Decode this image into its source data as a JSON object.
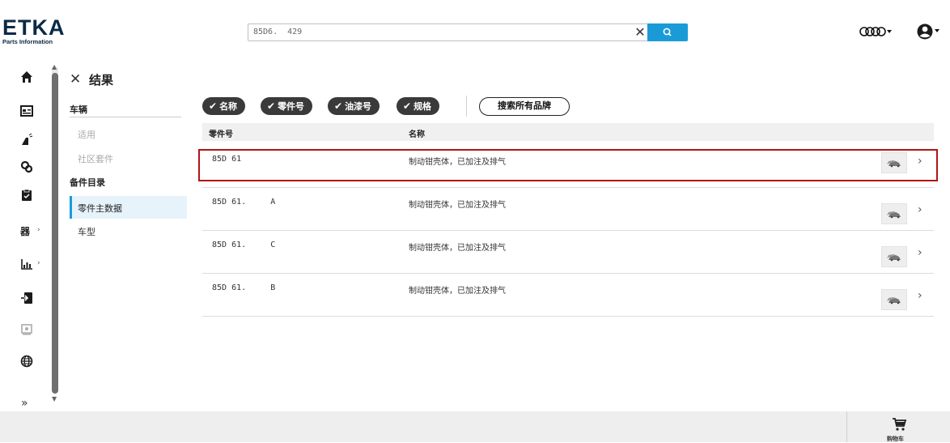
{
  "app": {
    "logo_title": "ETKA",
    "logo_subtitle": "Parts Information"
  },
  "search": {
    "value": "85D6.  429"
  },
  "sidebar": {
    "icons": [
      "home-icon",
      "catalog-icon",
      "tools-icon",
      "parts-icon",
      "clipboard-icon",
      "vin-icon",
      "chart-icon",
      "import-icon",
      "viewer-icon",
      "globe-icon"
    ],
    "expand_label": "»"
  },
  "panel": {
    "close_label": "✕",
    "title": "结果",
    "section_vehicle": "车辆",
    "item_applicable": "适用",
    "item_community_kit": "社区套件",
    "section_parts_catalog": "备件目录",
    "item_parts_master": "零件主数据",
    "item_model": "车型"
  },
  "filters": {
    "chips": [
      "名称",
      "零件号",
      "油漆号",
      "规格"
    ],
    "search_all_brands": "搜索所有品牌"
  },
  "table": {
    "headers": {
      "part_no": "零件号",
      "name": "名称"
    },
    "rows": [
      {
        "part_no": "85D 61     ",
        "name": "制动钳壳体，已加注及排气"
      },
      {
        "part_no": "85D 61.     A",
        "name": "制动钳壳体，已加注及排气"
      },
      {
        "part_no": "85D 61.     C",
        "name": "制动钳壳体，已加注及排气"
      },
      {
        "part_no": "85D 61.     B",
        "name": "制动钳壳体，已加注及排气"
      }
    ]
  },
  "footer": {
    "cart_label": "购物车"
  },
  "colors": {
    "accent": "#1a9bd8",
    "highlight": "#b01515",
    "chip_bg": "#3a3a3a"
  }
}
